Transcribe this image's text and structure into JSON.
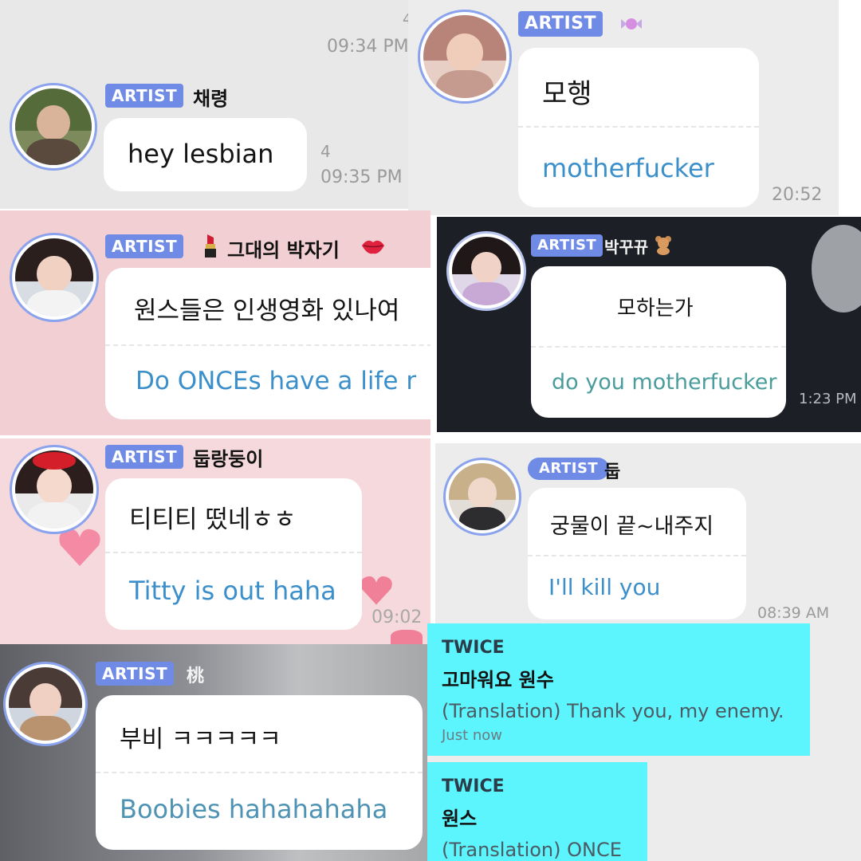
{
  "panels": [
    {
      "badge": "ARTIST",
      "name": "채령",
      "ko": "hey lesbian",
      "en": "",
      "count": "4",
      "time": "09:35 PM",
      "top_time": "09:34 PM",
      "top_count": "4"
    },
    {
      "badge": "ARTIST",
      "name_icon": "candy-emoji",
      "ko": "모행",
      "en": "motherfucker",
      "time": "20:52"
    },
    {
      "badge": "ARTIST",
      "name": "그대의 박자기",
      "name_icons": [
        "lipstick-emoji",
        "lips-emoji"
      ],
      "ko": "원스들은 인생영화 있나여",
      "en": "Do ONCEs have a life r"
    },
    {
      "badge": "ARTIST",
      "name": "박꾸뀨",
      "name_icon": "teddy-bear-emoji",
      "ko": "모하는가",
      "en": "do you motherfucker",
      "time": "1:23 PM"
    },
    {
      "badge": "ARTIST",
      "name": "둡랑둥이",
      "ko": "티티티 떴네ㅎㅎ",
      "en": "Titty is out haha",
      "time": "09:02"
    },
    {
      "badge": "ARTIST",
      "name": "둡",
      "ko": "궁물이 끝~내주지",
      "en": "I'll kill you",
      "time": "08:39 AM"
    },
    {
      "badge": "ARTIST",
      "name": "桃",
      "ko": "부비 ㅋㅋㅋㅋㅋ",
      "en": "Boobies hahahahaha"
    }
  ],
  "twice": [
    {
      "sender": "TWICE",
      "message": "고마워요 원수",
      "translation": "(Translation) Thank you, my enemy.",
      "time": "Just now"
    },
    {
      "sender": "TWICE",
      "message": "원스",
      "translation": "(Translation) ONCE"
    }
  ],
  "colors": {
    "badge": "#6f8be6",
    "translation_text": "#3b8fca",
    "twice_bg": "#5cf4fd"
  }
}
